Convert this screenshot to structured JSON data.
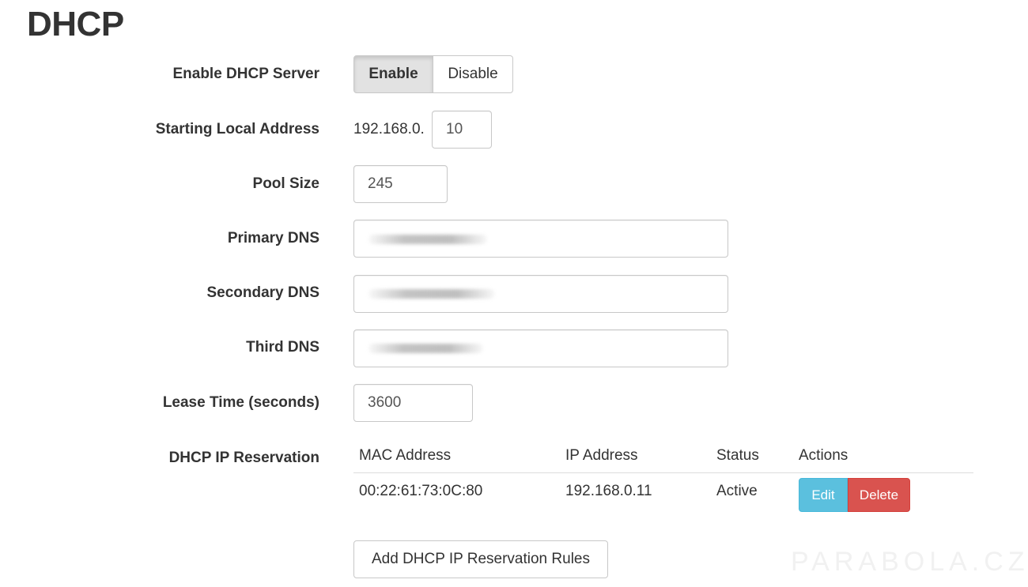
{
  "page": {
    "title": "DHCP"
  },
  "fields": {
    "enable_dhcp": {
      "label": "Enable DHCP Server",
      "options": [
        "Enable",
        "Disable"
      ],
      "selected": "Enable"
    },
    "start_address": {
      "label": "Starting Local Address",
      "prefix": "192.168.0.",
      "value": "10"
    },
    "pool_size": {
      "label": "Pool Size",
      "value": "245"
    },
    "primary_dns": {
      "label": "Primary DNS",
      "value": ""
    },
    "secondary_dns": {
      "label": "Secondary DNS",
      "value": ""
    },
    "third_dns": {
      "label": "Third DNS",
      "value": ""
    },
    "lease_time": {
      "label": "Lease Time (seconds)",
      "value": "3600"
    }
  },
  "reservation": {
    "label": "DHCP IP Reservation",
    "columns": [
      "MAC Address",
      "IP Address",
      "Status",
      "Actions"
    ],
    "rows": [
      {
        "mac": "00:22:61:73:0C:80",
        "ip": "192.168.0.11",
        "status": "Active",
        "edit_label": "Edit",
        "delete_label": "Delete"
      }
    ],
    "add_button": "Add DHCP IP Reservation Rules"
  },
  "watermark": "PARABOLA.CZ",
  "colors": {
    "edit": "#5bc0de",
    "delete": "#d9534f",
    "active_toggle": "#e2e2e2"
  }
}
